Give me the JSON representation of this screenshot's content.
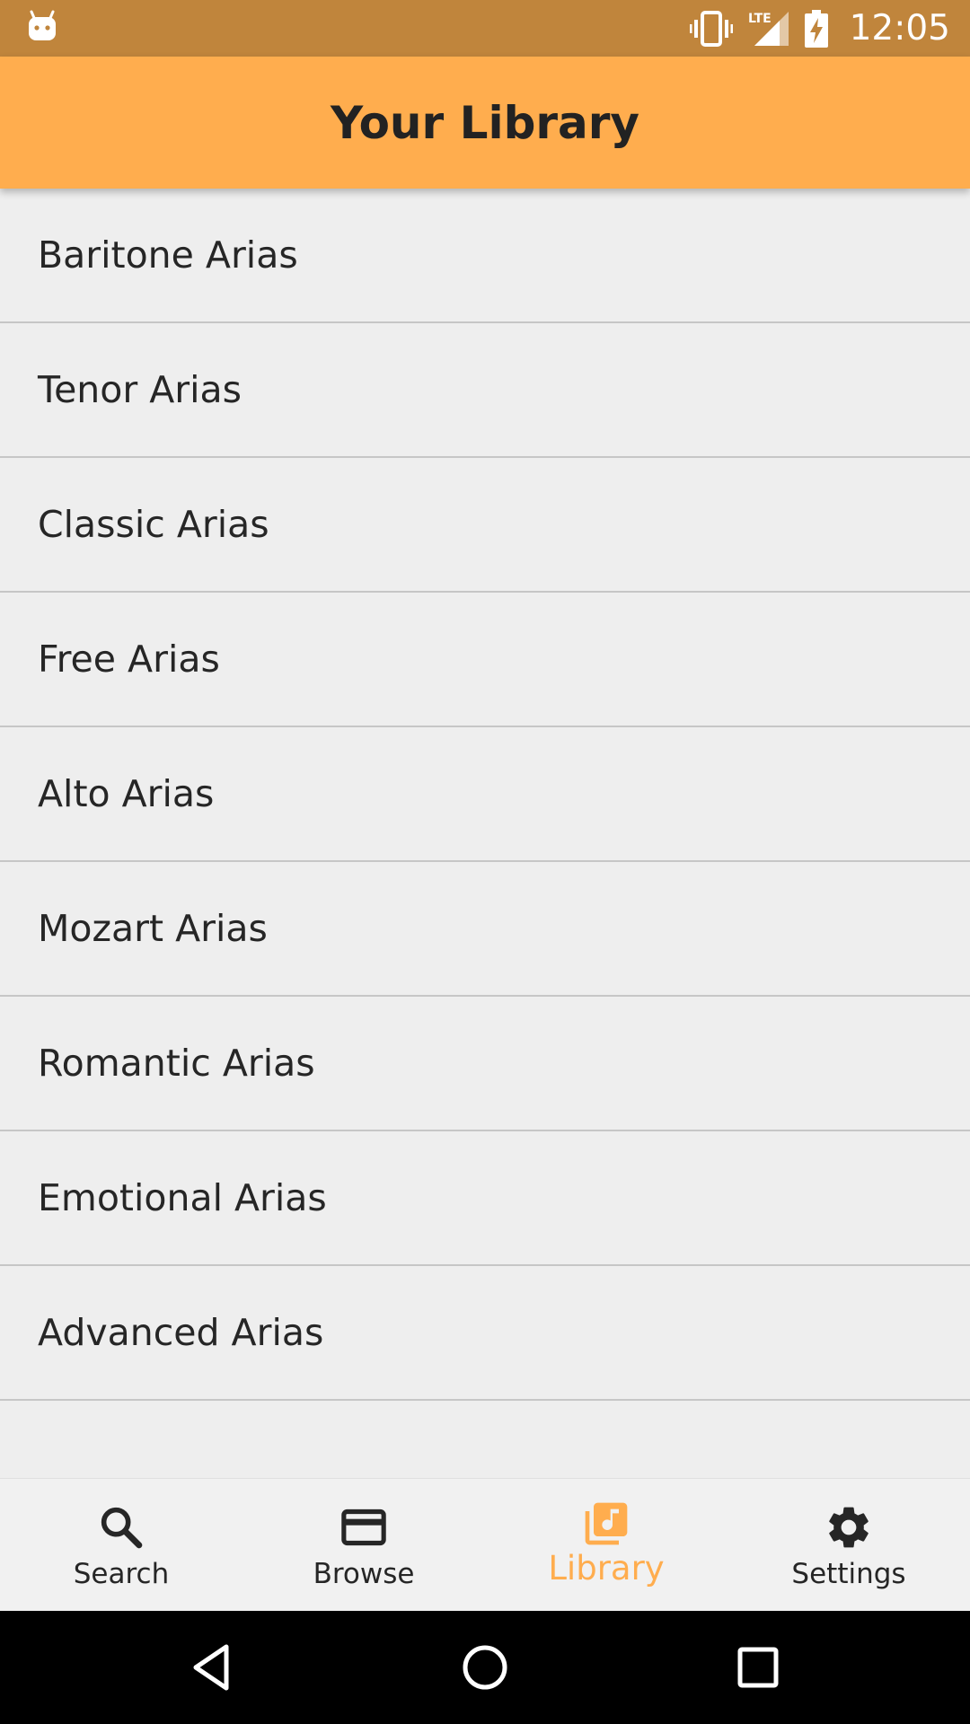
{
  "status_bar": {
    "time": "12:05",
    "icons": [
      "android-icon",
      "vibrate-icon",
      "lte-signal-icon",
      "battery-charging-icon"
    ]
  },
  "app_bar": {
    "title": "Your Library"
  },
  "library": {
    "items": [
      {
        "label": "Baritone Arias"
      },
      {
        "label": "Tenor Arias"
      },
      {
        "label": "Classic Arias"
      },
      {
        "label": "Free Arias"
      },
      {
        "label": "Alto Arias"
      },
      {
        "label": "Mozart Arias"
      },
      {
        "label": "Romantic Arias"
      },
      {
        "label": "Emotional Arias"
      },
      {
        "label": "Advanced Arias"
      }
    ]
  },
  "bottom_nav": {
    "active": "Library",
    "items": [
      {
        "label": "Search",
        "icon": "search-icon"
      },
      {
        "label": "Browse",
        "icon": "card-icon"
      },
      {
        "label": "Library",
        "icon": "library-music-icon"
      },
      {
        "label": "Settings",
        "icon": "gear-icon"
      }
    ]
  },
  "system_nav": {
    "buttons": [
      "back-icon",
      "home-icon",
      "recents-icon"
    ]
  },
  "colors": {
    "status_bar": "#c0853c",
    "app_bar": "#ffad4e",
    "accent": "#ffad4e",
    "background": "#eeeeee",
    "divider": "#c6c6c6"
  }
}
